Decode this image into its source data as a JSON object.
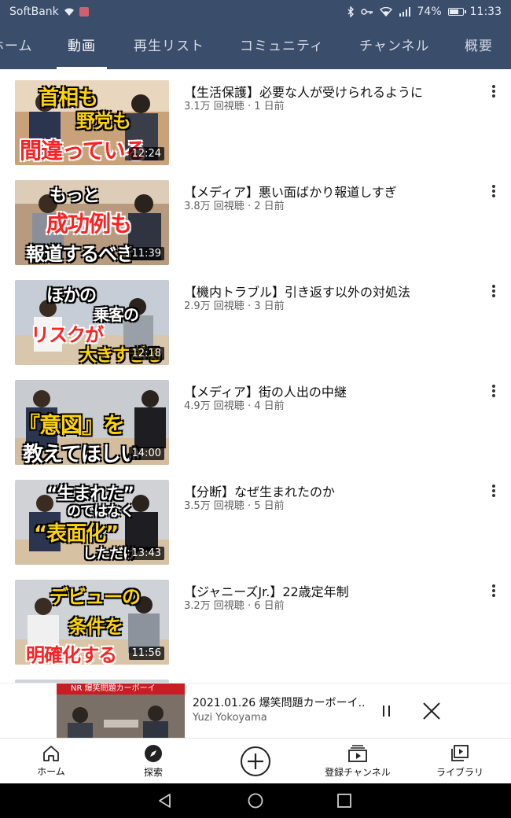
{
  "status_bar": {
    "carrier": "SoftBank",
    "battery_percent": "74%",
    "battery_level": 0.74,
    "time": "11:33"
  },
  "tabs": [
    {
      "label": "ホーム",
      "active": false
    },
    {
      "label": "動画",
      "active": true
    },
    {
      "label": "再生リスト",
      "active": false
    },
    {
      "label": "コミュニティ",
      "active": false
    },
    {
      "label": "チャンネル",
      "active": false
    },
    {
      "label": "概要",
      "active": false
    }
  ],
  "videos": [
    {
      "title": "【生活保護】必要な人が受けられるように",
      "meta": "3.1万 回視聴 · 1 日前",
      "duration": "12:24",
      "thumb_lines": [
        "首相も",
        "野党も",
        "間違っている"
      ],
      "thumb_bg": "#c9a27a"
    },
    {
      "title": "【メディア】悪い面ばかり報道しすぎ",
      "meta": "3.8万 回視聴 · 2 日前",
      "duration": "11:39",
      "thumb_lines": [
        "もっと",
        "成功例も",
        "報道するべき"
      ],
      "thumb_bg": "#b89a7e"
    },
    {
      "title": "【機内トラブル】引き返す以外の対処法",
      "meta": "2.9万 回視聴 · 3 日前",
      "duration": "12:18",
      "thumb_lines": [
        "ほかの",
        "乗客の",
        "リスクが",
        "大きすぎる"
      ],
      "thumb_bg": "#c7cdd6"
    },
    {
      "title": "【メディア】街の人出の中継",
      "meta": "4.9万 回視聴 · 4 日前",
      "duration": "14:00",
      "thumb_lines": [
        "『意図』を",
        "教えてほしい"
      ],
      "thumb_bg": "#c8cbd0"
    },
    {
      "title": "【分断】なぜ生まれたのか",
      "meta": "3.5万 回視聴 · 5 日前",
      "duration": "13:43",
      "thumb_lines": [
        "“生まれた”",
        "のではなく",
        "“表面化”",
        "しただけ"
      ],
      "thumb_bg": "#d0d2d6"
    },
    {
      "title": "【ジャニーズJr.】22歳定年制",
      "meta": "3.2万 回視聴 · 6 日前",
      "duration": "11:56",
      "thumb_lines": [
        "デビューの",
        "条件を",
        "明確化する"
      ],
      "thumb_bg": "#cfd3d8"
    },
    {
      "title": "",
      "meta": "",
      "duration": "",
      "thumb_lines": [],
      "thumb_bg": "#cfd3d8"
    }
  ],
  "mini_player": {
    "thumb_banner": "NR 爆笑問題カーボーイ",
    "title": "2021.01.26 爆笑問題カーボーイ...",
    "channel": "Yuzi Yokoyama"
  },
  "bottom_nav": [
    {
      "label": "ホーム",
      "icon": "home-icon"
    },
    {
      "label": "探索",
      "icon": "explore-icon"
    },
    {
      "label": "",
      "icon": "add-icon"
    },
    {
      "label": "登録チャンネル",
      "icon": "subscriptions-icon"
    },
    {
      "label": "ライブラリ",
      "icon": "library-icon"
    }
  ]
}
